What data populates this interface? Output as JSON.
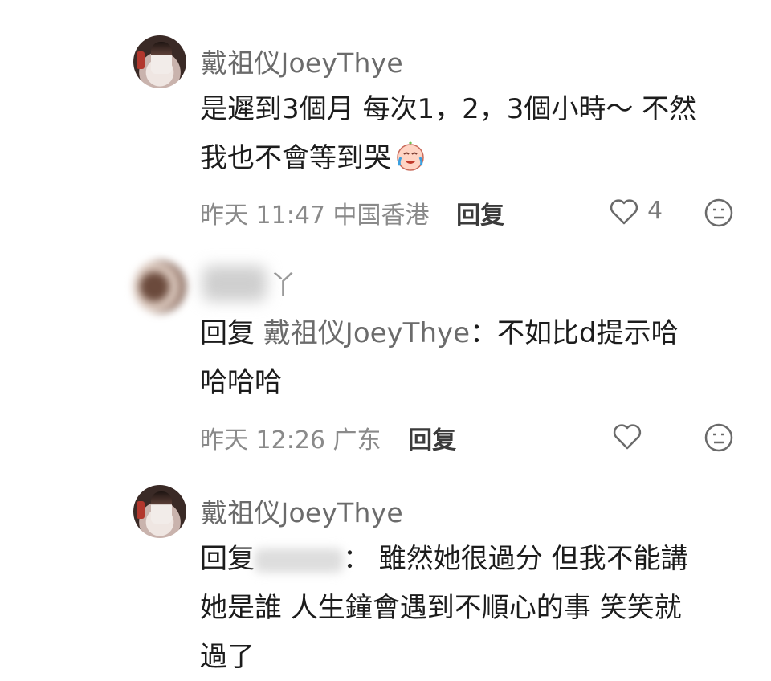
{
  "comments": [
    {
      "author": "戴祖仪JoeyThye",
      "text_line1": "是遲到3個月 每次1，2，3個小時～ 不然",
      "text_line2": "我也不會等到哭",
      "time": "昨天 11:47",
      "location": "中国香港",
      "reply_label": "回复",
      "likes": "4"
    },
    {
      "author_suffix": "丫",
      "reply_prefix": "回复",
      "mention": "戴祖仪JoeyThye",
      "text_line1_rest": "：不如比d提示哈",
      "text_line2": "哈哈哈",
      "time": "昨天 12:26",
      "location": "广东",
      "reply_label": "回复"
    },
    {
      "author": "戴祖仪JoeyThye",
      "reply_prefix": "回复",
      "text_line1_rest": "： 雖然她很過分 但我不能講",
      "text_line2": "她是誰 人生鐘會遇到不順心的事 笑笑就",
      "text_line3": "過了"
    }
  ],
  "icons": {
    "heart": "heart-icon",
    "face": "neutral-face-icon",
    "emoji": "crying-laugh-emoji"
  },
  "colors": {
    "text": "#1c1c1c",
    "meta": "#8a8a8a",
    "name": "#6b6b6b"
  }
}
